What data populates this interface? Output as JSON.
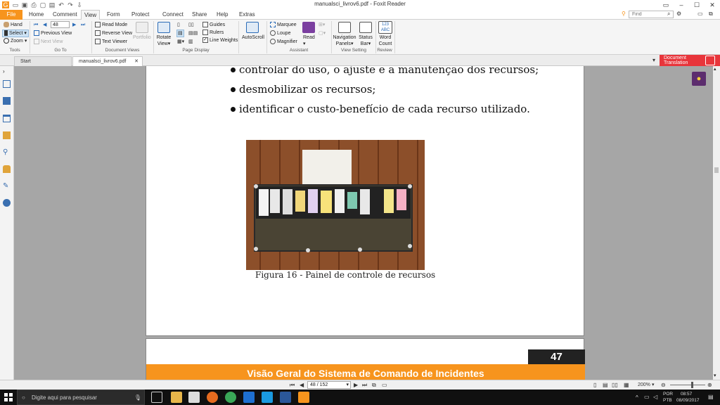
{
  "window": {
    "title": "manualsci_livrov6.pdf - Foxit Reader"
  },
  "menu": {
    "file": "File",
    "home": "Home",
    "comment": "Comment",
    "view": "View",
    "form": "Form",
    "protect": "Protect",
    "connect": "Connect",
    "share": "Share",
    "help": "Help",
    "extras": "Extras"
  },
  "find": {
    "placeholder": "Find"
  },
  "ribbon": {
    "tools": {
      "hand": "Hand",
      "select": "Select",
      "zoom": "Zoom",
      "group": "Tools"
    },
    "goto": {
      "page_value": "48",
      "previous_view": "Previous View",
      "next_view": "Next View",
      "group": "Go To"
    },
    "document_views": {
      "read_mode": "Read Mode",
      "reverse_view": "Reverse View",
      "text_viewer": "Text Viewer",
      "portfolio": "Portfolio",
      "group": "Document Views"
    },
    "page_display": {
      "rotate_view": "Rotate View",
      "guides": "Guides",
      "rulers": "Rulers",
      "line_weights": "Line Weights",
      "group": "Page Display"
    },
    "autoscroll": "AutoScroll",
    "assistant": {
      "marquee": "Marquee",
      "loupe": "Loupe",
      "magnifier": "Magnifier",
      "read": "Read",
      "group": "Assistant"
    },
    "view_setting": {
      "navigation_panels": "Navigation Panels",
      "status_bar": "Status Bar",
      "group": "View Setting"
    },
    "review": {
      "word_count": "Word Count",
      "word_count_icon": "123 ABC",
      "group": "Review"
    }
  },
  "tabs": {
    "start": "Start",
    "document": "manualsci_livrov6.pdf"
  },
  "document_translation": "Document Translation",
  "page_content": {
    "bullets": [
      "controlar do uso, o ajuste e a manutenção dos recursos;",
      "desmobilizar os recursos;",
      "identificar o custo-benefício de cada recurso utilizado."
    ],
    "caption": "Figura 16 - Painel de controle de recursos",
    "page_number": "47",
    "footer_title": "Visão Geral do Sistema de Comando de Incidentes"
  },
  "status": {
    "page_indicator": "48 / 152",
    "zoom": "200%"
  },
  "taskbar": {
    "search_placeholder": "Digite aqui para pesquisar",
    "lang": "POR",
    "layout": "PTB",
    "time": "08:57",
    "date": "08/09/2017"
  },
  "colors": {
    "accent": "#f7941d",
    "translation": "#e8353b",
    "tips": "#5c2d6e"
  }
}
